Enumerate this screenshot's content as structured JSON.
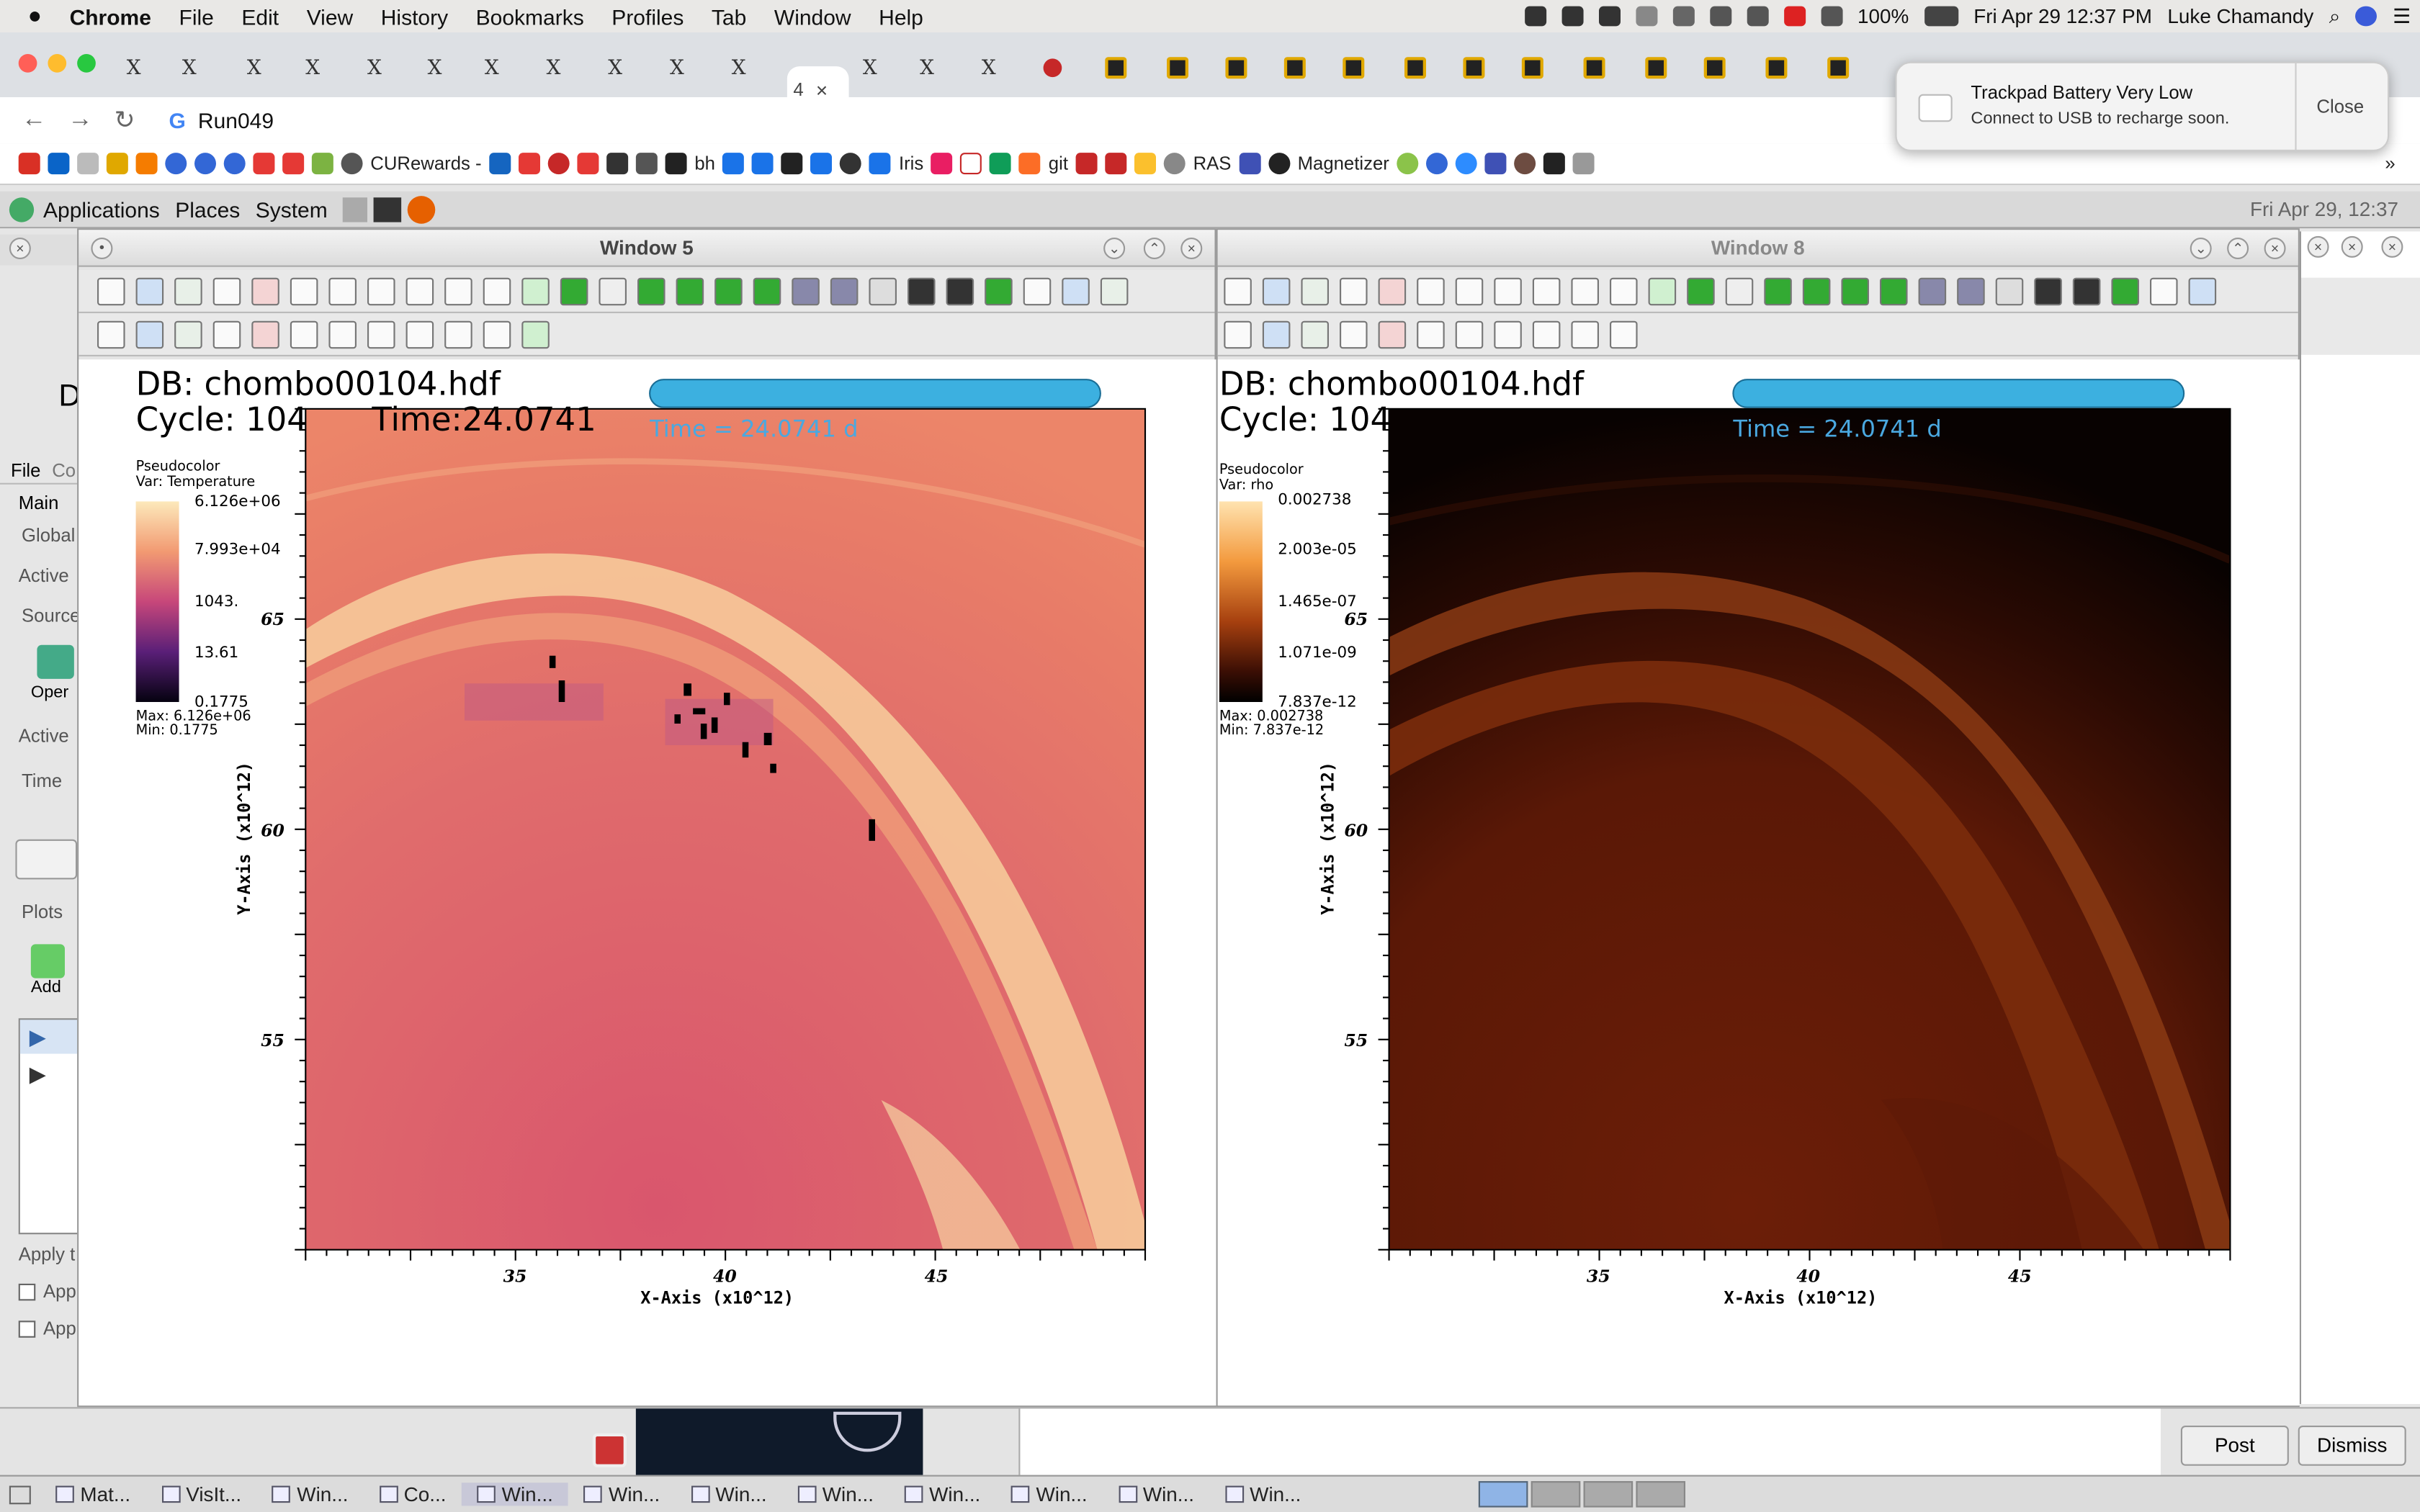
{
  "menubar": {
    "app": "Chrome",
    "items": [
      "File",
      "Edit",
      "View",
      "History",
      "Bookmarks",
      "Profiles",
      "Tab",
      "Window",
      "Help"
    ],
    "battery": "100%",
    "clock": "Fri Apr 29  12:37 PM",
    "user": "Luke Chamandy"
  },
  "tabs": {
    "active_label": "4"
  },
  "address": {
    "url": "Run049"
  },
  "bookmarks": {
    "items": [
      "CURewards -",
      "bh",
      "Iris",
      "git",
      "RAS",
      "Magnetizer"
    ]
  },
  "notification": {
    "title": "Trackpad Battery Very Low",
    "body": "Connect to USB to recharge soon.",
    "close": "Close"
  },
  "gnome": {
    "items": [
      "Applications",
      "Places",
      "System"
    ],
    "clock": "Fri Apr 29, 12:37"
  },
  "bg_visit": {
    "menu_file": "File",
    "menu_c": "Co",
    "labels": [
      "Main",
      "Global",
      "Active",
      "Source",
      "Oper",
      "Active",
      "Time",
      "Plots",
      "Add",
      "Apply t",
      "App",
      "App"
    ]
  },
  "window5": {
    "title": "Window 5",
    "db": "DB: chombo00104.hdf",
    "cycle": "Cycle: 104",
    "time": "Time:24.0741",
    "time_banner": "Time = 24.0741 d",
    "legend": {
      "type": "Pseudocolor",
      "var": "Var: Temperature",
      "ticks": [
        "6.126e+06",
        "7.993e+04",
        "1043.",
        "13.61",
        "0.1775"
      ],
      "max": "Max: 6.126e+06",
      "min": "Min: 0.1775"
    },
    "xlabel": "X-Axis  (x10^12)",
    "ylabel": "Y-Axis  (x10^12)",
    "xticks": [
      "35",
      "40",
      "45"
    ],
    "yticks": [
      "65",
      "60",
      "55"
    ]
  },
  "window8": {
    "title": "Window 8",
    "db": "DB: chombo00104.hdf",
    "cycle": "Cycle: 104",
    "time_banner": "Time = 24.0741 d",
    "legend": {
      "type": "Pseudocolor",
      "var": "Var: rho",
      "ticks": [
        "0.002738",
        "2.003e-05",
        "1.465e-07",
        "1.071e-09",
        "7.837e-12"
      ],
      "max": "Max: 0.002738",
      "min": "Min: 7.837e-12"
    },
    "xlabel": "X-Axis  (x10^12)",
    "ylabel": "Y-Axis  (x10^12)",
    "xticks": [
      "35",
      "40",
      "45"
    ],
    "yticks": [
      "65",
      "60",
      "55"
    ]
  },
  "dialog": {
    "post": "Post",
    "dismiss": "Dismiss"
  },
  "taskbar": {
    "items": [
      "Mat...",
      "VisIt...",
      "Win...",
      "Co...",
      "Win...",
      "Win...",
      "Win...",
      "Win...",
      "Win...",
      "Win...",
      "Win...",
      "Win..."
    ]
  }
}
